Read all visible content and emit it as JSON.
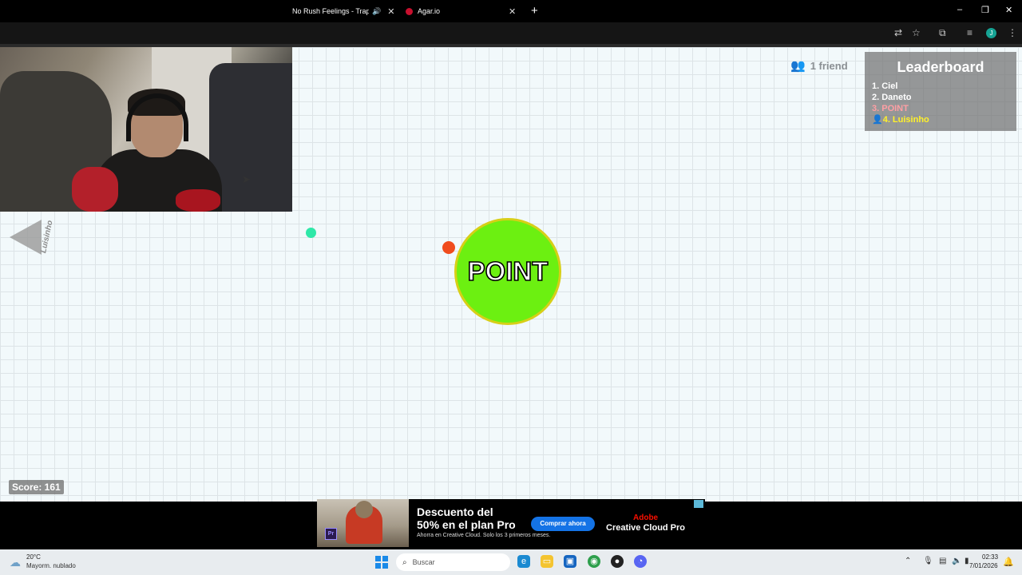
{
  "browser": {
    "tabs": [
      {
        "title": "No Rush Feelings - Trap - M",
        "audio_icon": "speaker-icon"
      },
      {
        "title": "Agar.io"
      }
    ],
    "new_tab": "+",
    "window_controls": [
      "–",
      "❐",
      "✕"
    ],
    "profile_initial": "J"
  },
  "game": {
    "friends_label": "1 friend",
    "leaderboard": {
      "title": "Leaderboard",
      "entries": [
        {
          "text": "1. Ciel",
          "kind": "normal"
        },
        {
          "text": "2. Daneto",
          "kind": "normal"
        },
        {
          "text": "3. POINT",
          "kind": "self"
        },
        {
          "text": "4. Luisinho",
          "kind": "friend"
        }
      ]
    },
    "offscreen_friend": "Luisinho",
    "player_cell": {
      "name": "POINT",
      "color": "#6cf011",
      "border": "#d7cf17"
    },
    "food_colors": [
      "#2ee8a8",
      "#f04c1d"
    ],
    "score": "Score: 161"
  },
  "ad": {
    "headline_1": "Descuento del",
    "headline_2": "50% en el plan Pro",
    "subtext": "Ahorra en Creative Cloud. Solo los 3 primeros meses.",
    "button": "Comprar ahora",
    "brand_top": "Adobe",
    "brand": "Creative Cloud Pro",
    "app_badge": "Pr"
  },
  "taskbar": {
    "weather_temp": "20°C",
    "weather_desc": "Mayorm. nublado",
    "search_placeholder": "Buscar",
    "time": "02:33",
    "date": "7/01/2026"
  }
}
